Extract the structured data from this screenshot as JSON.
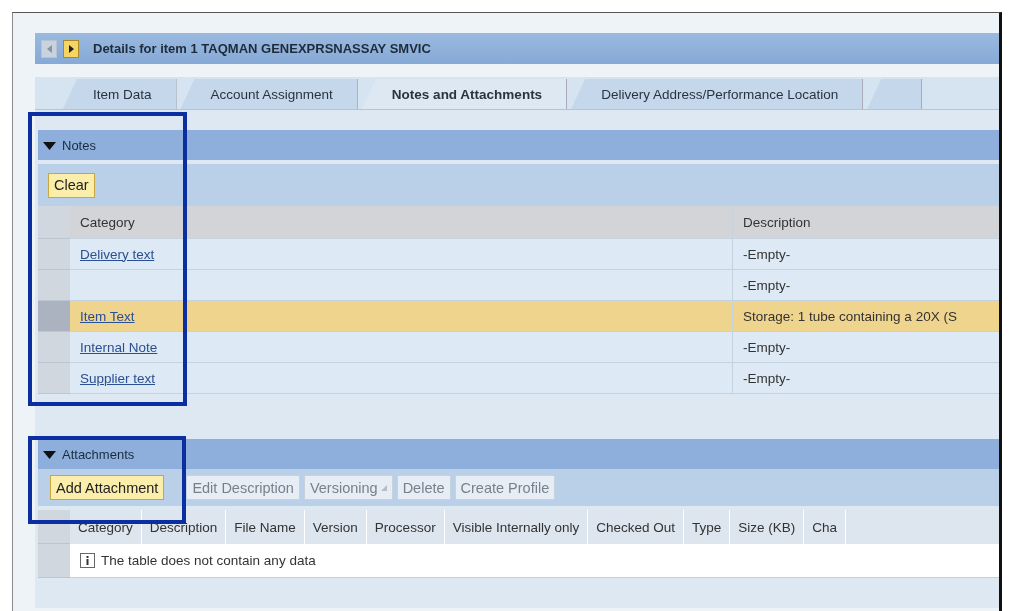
{
  "title_bar": {
    "nav_buttons": [
      {
        "kind": "previous",
        "disabled": true
      },
      {
        "kind": "next",
        "disabled": false
      }
    ],
    "title": "Details for item 1  TAQMAN GENEXPRSNASSAY SMVIC"
  },
  "tabs": [
    {
      "label": "Item Data",
      "selected": false
    },
    {
      "label": "Account Assignment",
      "selected": false
    },
    {
      "label": "Notes and Attachments",
      "selected": true
    },
    {
      "label": "Delivery Address/Performance Location",
      "selected": false
    },
    {
      "selected": false
    }
  ],
  "notes": {
    "title": "Notes",
    "expanded": true,
    "buttons": [
      {
        "label": "Clear",
        "disabled": false
      }
    ],
    "columns": [
      "Category",
      "Description"
    ],
    "rows": [
      {
        "category": "Delivery text",
        "description": "-Empty-",
        "selected": false
      },
      {
        "category": "",
        "description": "-Empty-",
        "selected": false
      },
      {
        "category": "Item Text",
        "description": "Storage: 1 tube containing a 20X (S",
        "selected": true
      },
      {
        "category": "Internal Note",
        "description": "-Empty-",
        "selected": false
      },
      {
        "category": "Supplier text",
        "description": "-Empty-",
        "selected": false
      }
    ]
  },
  "attachments": {
    "title": "Attachments",
    "expanded": true,
    "buttons": [
      {
        "label": "Add Attachment",
        "disabled": false,
        "kind": "plain"
      },
      {
        "label": "Edit Description",
        "disabled": true,
        "kind": "plain"
      },
      {
        "label": "Versioning",
        "disabled": true,
        "kind": "menu"
      },
      {
        "label": "Delete",
        "disabled": true,
        "kind": "plain"
      },
      {
        "label": "Create Profile",
        "disabled": true,
        "kind": "plain"
      }
    ],
    "columns": [
      "Category",
      "Description",
      "File Name",
      "Version",
      "Processor",
      "Visible Internally only",
      "Checked Out",
      "Type",
      "Size (KB)",
      "Cha"
    ],
    "empty_message": "The table does not contain any data"
  }
}
